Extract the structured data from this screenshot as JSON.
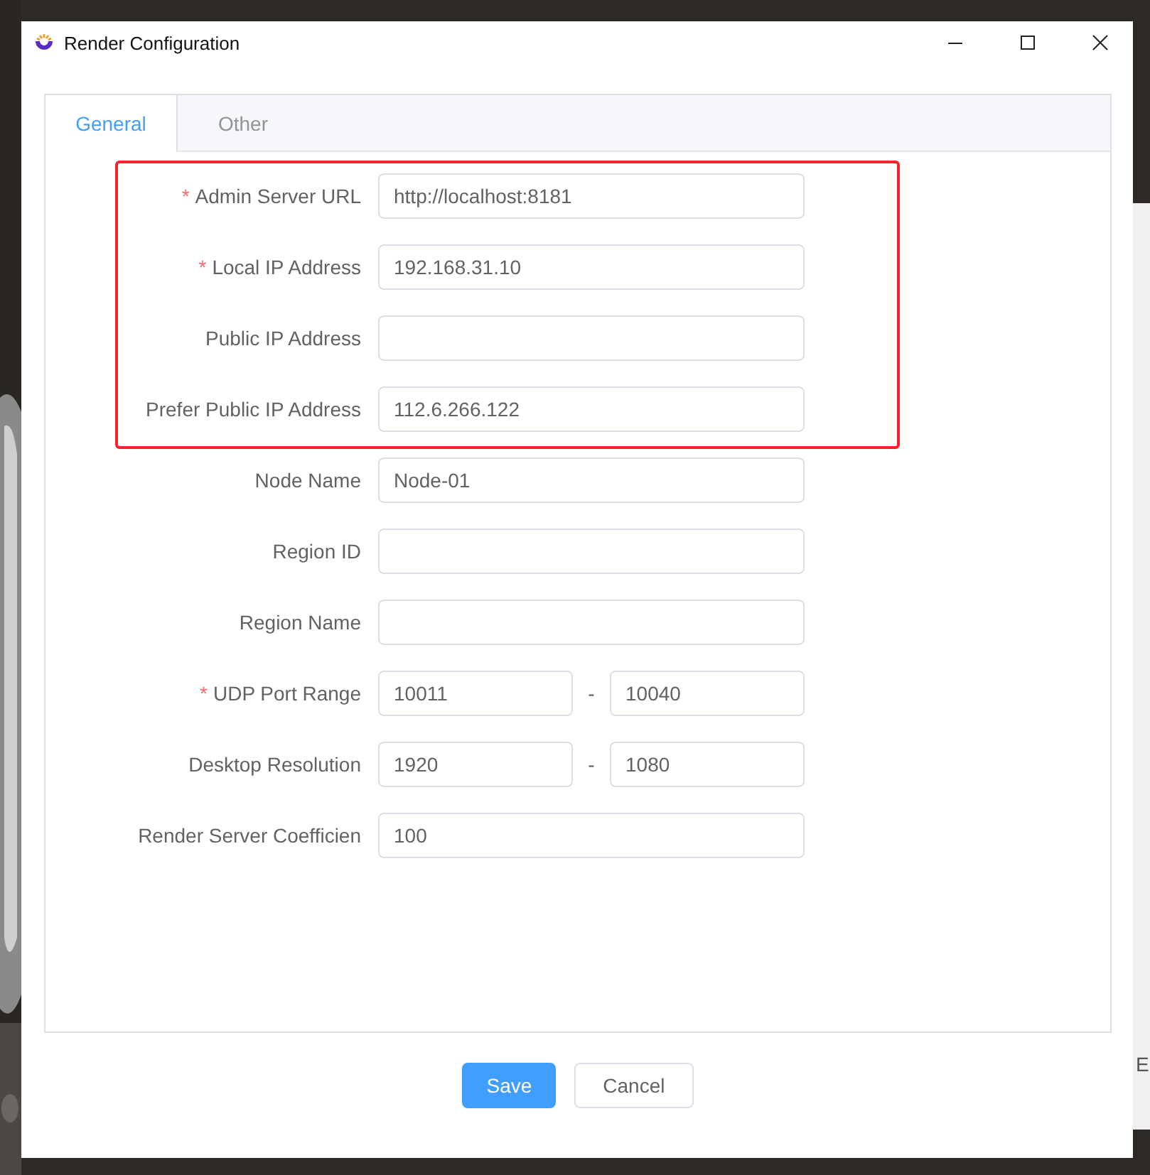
{
  "window": {
    "title": "Render Configuration"
  },
  "background_window": {
    "text": "E"
  },
  "tabs": [
    {
      "label": "General",
      "selected": true
    },
    {
      "label": "Other",
      "selected": false
    }
  ],
  "form": {
    "highlighted_fields": [
      {
        "label": "Admin Server URL",
        "required_mark": "*",
        "kind": "text",
        "value": "http://localhost:8181"
      },
      {
        "label": "Local IP Address",
        "required_mark": "*",
        "kind": "text",
        "value": "192.168.31.10"
      },
      {
        "label": "Public IP Address",
        "kind": "text"
      },
      {
        "label": "Prefer Public IP Address",
        "kind": "text",
        "value": "112.6.266.122"
      }
    ],
    "fields": [
      {
        "label": "Node Name",
        "kind": "text",
        "value": "Node-01"
      },
      {
        "label": "Region ID",
        "kind": "text"
      },
      {
        "label": "Region Name",
        "kind": "text"
      },
      {
        "label": "UDP Port Range",
        "required_mark": "*",
        "kind": "range",
        "values": [
          "10011",
          "10040"
        ],
        "separator": "-"
      },
      {
        "label": "Desktop Resolution",
        "kind": "range",
        "values": [
          "1920",
          "1080"
        ],
        "separator": "-"
      },
      {
        "label": "Render Server Coefficien",
        "kind": "text",
        "value": "100"
      }
    ]
  },
  "buttons": [
    {
      "label": "Save",
      "kind": "primary"
    },
    {
      "label": "Cancel",
      "kind": "default"
    }
  ]
}
